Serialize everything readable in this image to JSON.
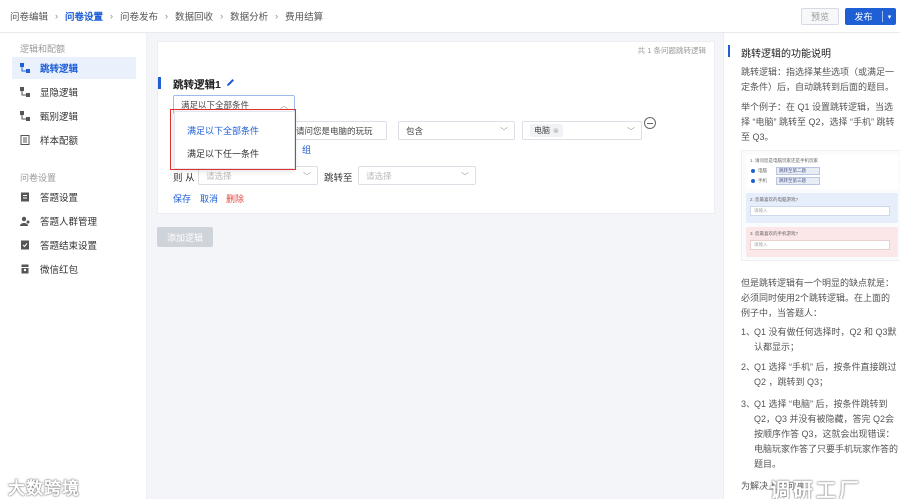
{
  "breadcrumb": [
    "问卷编辑",
    "问卷设置",
    "问卷发布",
    "数据回收",
    "数据分析",
    "费用结算"
  ],
  "header": {
    "preview_label": "预览",
    "publish_label": "发布"
  },
  "sidebar": {
    "group1_title": "逻辑和配额",
    "group1_items": [
      {
        "label": "跳转逻辑",
        "icon": "jump-logic-icon"
      },
      {
        "label": "显隐逻辑",
        "icon": "show-hide-logic-icon"
      },
      {
        "label": "甄别逻辑",
        "icon": "screen-logic-icon"
      },
      {
        "label": "样本配额",
        "icon": "sample-quota-icon"
      }
    ],
    "group2_title": "问卷设置",
    "group2_items": [
      {
        "label": "答题设置",
        "icon": "answer-settings-icon"
      },
      {
        "label": "答题人群管理",
        "icon": "respondent-group-icon"
      },
      {
        "label": "答题结束设置",
        "icon": "answer-end-icon"
      },
      {
        "label": "微信红包",
        "icon": "wechat-redpacket-icon"
      }
    ]
  },
  "main": {
    "count_note": "共 1 条问题跳转逻辑",
    "logic_title": "跳转逻辑1",
    "condition_mode": "满足以下全部条件",
    "question_select": "请问您是电脑的玩玩",
    "operator_select": "包含",
    "value_tag": "电脑",
    "add_condition": "组",
    "then_label": "则 从",
    "from_placeholder": "请选择",
    "jump_label": "跳转至",
    "to_placeholder": "请选择",
    "save": "保存",
    "cancel": "取消",
    "delete": "删除",
    "add_logic": "添加逻辑",
    "dropdown_options": [
      "满足以下全部条件",
      "满足以下任一条件"
    ]
  },
  "help_panel": {
    "title": "跳转逻辑的功能说明",
    "para1": "跳转逻辑：指选择某些选项（或满足一定条件）后，自动跳转到后面的题目。",
    "para2": "举个例子：在 Q1 设置跳转逻辑，当选择 “电脑” 跳转至 Q2，选择 “手机” 跳转至 Q3。",
    "illustration": {
      "q1_title": "1. 请问您是电脑玩家还是手机玩家",
      "opt1": "电脑",
      "opt1_jump": "跳转至第二题",
      "opt2": "手机",
      "opt2_jump": "跳转至第三题",
      "q2_title": "2. 您最喜欢的电脑游戏?",
      "q2_placeholder": "请输入",
      "q3_title": "3. 您最喜欢的手机游戏?",
      "q3_placeholder": "请输入"
    },
    "para3": "但是跳转逻辑有一个明显的缺点就是：必须同时使用2个跳转逻辑。在上面的例子中，当答题人：",
    "list": [
      "Q1 没有做任何选择时，Q2 和 Q3默认都显示；",
      "Q1 选择 “手机” 后，按条件直接跳过Q2 ，跳转到 Q3；",
      "Q1 选择 “电脑” 后，按条件跳转到 Q2，Q3 并没有被隐藏，答完 Q2会按顺序作答 Q3，这就会出现错误：电脑玩家作答了只要手机玩家作答的题目。"
    ],
    "tail": "为解决上述问题"
  },
  "watermarks": {
    "left": "大数跨境",
    "right": "调研工厂"
  },
  "colors": {
    "accent": "#1f5fd6",
    "highlight_border": "#e0302f",
    "danger": "#e04a3f"
  }
}
